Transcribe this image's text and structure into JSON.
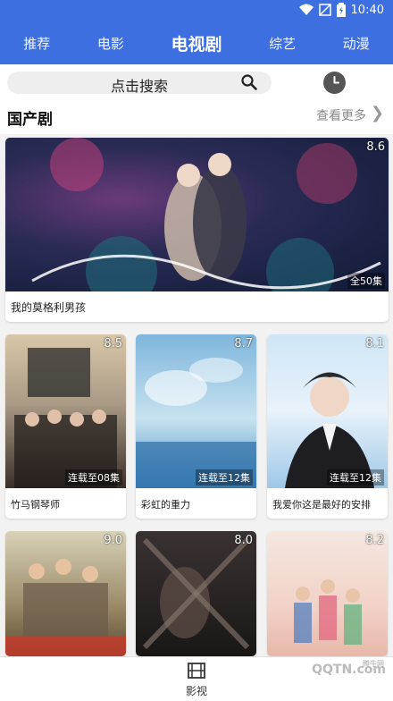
{
  "status": {
    "time": "10:40"
  },
  "nav": {
    "tabs": [
      {
        "label": "推荐"
      },
      {
        "label": "电影"
      },
      {
        "label": "电视剧"
      },
      {
        "label": "综艺"
      },
      {
        "label": "动漫"
      }
    ],
    "active_index": 2
  },
  "search": {
    "placeholder": "点击搜索"
  },
  "section": {
    "title": "国产剧",
    "more": "查看更多"
  },
  "featured": {
    "title": "我的莫格利男孩",
    "rating": "8.6",
    "episodes": "全50集"
  },
  "grid": [
    {
      "title": "竹马钢琴师",
      "rating": "8.5",
      "episodes": "连载至08集"
    },
    {
      "title": "彩虹的重力",
      "rating": "8.7",
      "episodes": "连载至12集"
    },
    {
      "title": "我爱你这是最好的安排",
      "rating": "8.1",
      "episodes": "连载至12集"
    },
    {
      "title": "",
      "rating": "9.0",
      "episodes": ""
    },
    {
      "title": "",
      "rating": "8.0",
      "episodes": ""
    },
    {
      "title": "",
      "rating": "8.2",
      "episodes": ""
    }
  ],
  "bottom_nav": {
    "label": "影视"
  },
  "watermark": {
    "text": "QQTN.com",
    "tag": "腾牛网"
  },
  "colors": {
    "primary": "#3d6fe0"
  }
}
